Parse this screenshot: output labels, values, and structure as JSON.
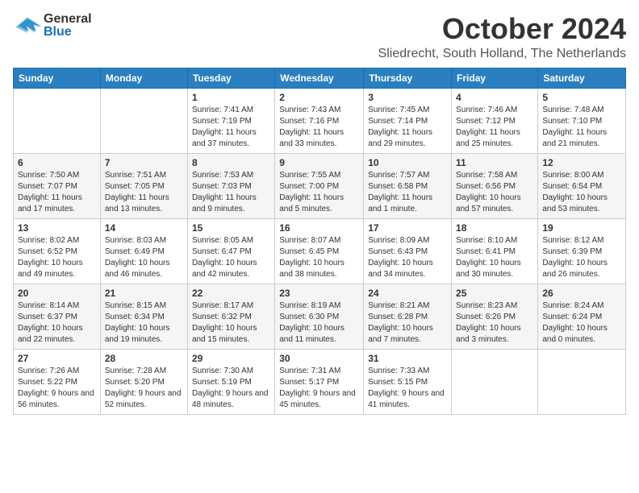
{
  "header": {
    "logo_general": "General",
    "logo_blue": "Blue",
    "month": "October 2024",
    "location": "Sliedrecht, South Holland, The Netherlands"
  },
  "days_of_week": [
    "Sunday",
    "Monday",
    "Tuesday",
    "Wednesday",
    "Thursday",
    "Friday",
    "Saturday"
  ],
  "weeks": [
    [
      {
        "day": "",
        "sunrise": "",
        "sunset": "",
        "daylight": ""
      },
      {
        "day": "",
        "sunrise": "",
        "sunset": "",
        "daylight": ""
      },
      {
        "day": "1",
        "sunrise": "Sunrise: 7:41 AM",
        "sunset": "Sunset: 7:19 PM",
        "daylight": "Daylight: 11 hours and 37 minutes."
      },
      {
        "day": "2",
        "sunrise": "Sunrise: 7:43 AM",
        "sunset": "Sunset: 7:16 PM",
        "daylight": "Daylight: 11 hours and 33 minutes."
      },
      {
        "day": "3",
        "sunrise": "Sunrise: 7:45 AM",
        "sunset": "Sunset: 7:14 PM",
        "daylight": "Daylight: 11 hours and 29 minutes."
      },
      {
        "day": "4",
        "sunrise": "Sunrise: 7:46 AM",
        "sunset": "Sunset: 7:12 PM",
        "daylight": "Daylight: 11 hours and 25 minutes."
      },
      {
        "day": "5",
        "sunrise": "Sunrise: 7:48 AM",
        "sunset": "Sunset: 7:10 PM",
        "daylight": "Daylight: 11 hours and 21 minutes."
      }
    ],
    [
      {
        "day": "6",
        "sunrise": "Sunrise: 7:50 AM",
        "sunset": "Sunset: 7:07 PM",
        "daylight": "Daylight: 11 hours and 17 minutes."
      },
      {
        "day": "7",
        "sunrise": "Sunrise: 7:51 AM",
        "sunset": "Sunset: 7:05 PM",
        "daylight": "Daylight: 11 hours and 13 minutes."
      },
      {
        "day": "8",
        "sunrise": "Sunrise: 7:53 AM",
        "sunset": "Sunset: 7:03 PM",
        "daylight": "Daylight: 11 hours and 9 minutes."
      },
      {
        "day": "9",
        "sunrise": "Sunrise: 7:55 AM",
        "sunset": "Sunset: 7:00 PM",
        "daylight": "Daylight: 11 hours and 5 minutes."
      },
      {
        "day": "10",
        "sunrise": "Sunrise: 7:57 AM",
        "sunset": "Sunset: 6:58 PM",
        "daylight": "Daylight: 11 hours and 1 minute."
      },
      {
        "day": "11",
        "sunrise": "Sunrise: 7:58 AM",
        "sunset": "Sunset: 6:56 PM",
        "daylight": "Daylight: 10 hours and 57 minutes."
      },
      {
        "day": "12",
        "sunrise": "Sunrise: 8:00 AM",
        "sunset": "Sunset: 6:54 PM",
        "daylight": "Daylight: 10 hours and 53 minutes."
      }
    ],
    [
      {
        "day": "13",
        "sunrise": "Sunrise: 8:02 AM",
        "sunset": "Sunset: 6:52 PM",
        "daylight": "Daylight: 10 hours and 49 minutes."
      },
      {
        "day": "14",
        "sunrise": "Sunrise: 8:03 AM",
        "sunset": "Sunset: 6:49 PM",
        "daylight": "Daylight: 10 hours and 46 minutes."
      },
      {
        "day": "15",
        "sunrise": "Sunrise: 8:05 AM",
        "sunset": "Sunset: 6:47 PM",
        "daylight": "Daylight: 10 hours and 42 minutes."
      },
      {
        "day": "16",
        "sunrise": "Sunrise: 8:07 AM",
        "sunset": "Sunset: 6:45 PM",
        "daylight": "Daylight: 10 hours and 38 minutes."
      },
      {
        "day": "17",
        "sunrise": "Sunrise: 8:09 AM",
        "sunset": "Sunset: 6:43 PM",
        "daylight": "Daylight: 10 hours and 34 minutes."
      },
      {
        "day": "18",
        "sunrise": "Sunrise: 8:10 AM",
        "sunset": "Sunset: 6:41 PM",
        "daylight": "Daylight: 10 hours and 30 minutes."
      },
      {
        "day": "19",
        "sunrise": "Sunrise: 8:12 AM",
        "sunset": "Sunset: 6:39 PM",
        "daylight": "Daylight: 10 hours and 26 minutes."
      }
    ],
    [
      {
        "day": "20",
        "sunrise": "Sunrise: 8:14 AM",
        "sunset": "Sunset: 6:37 PM",
        "daylight": "Daylight: 10 hours and 22 minutes."
      },
      {
        "day": "21",
        "sunrise": "Sunrise: 8:15 AM",
        "sunset": "Sunset: 6:34 PM",
        "daylight": "Daylight: 10 hours and 19 minutes."
      },
      {
        "day": "22",
        "sunrise": "Sunrise: 8:17 AM",
        "sunset": "Sunset: 6:32 PM",
        "daylight": "Daylight: 10 hours and 15 minutes."
      },
      {
        "day": "23",
        "sunrise": "Sunrise: 8:19 AM",
        "sunset": "Sunset: 6:30 PM",
        "daylight": "Daylight: 10 hours and 11 minutes."
      },
      {
        "day": "24",
        "sunrise": "Sunrise: 8:21 AM",
        "sunset": "Sunset: 6:28 PM",
        "daylight": "Daylight: 10 hours and 7 minutes."
      },
      {
        "day": "25",
        "sunrise": "Sunrise: 8:23 AM",
        "sunset": "Sunset: 6:26 PM",
        "daylight": "Daylight: 10 hours and 3 minutes."
      },
      {
        "day": "26",
        "sunrise": "Sunrise: 8:24 AM",
        "sunset": "Sunset: 6:24 PM",
        "daylight": "Daylight: 10 hours and 0 minutes."
      }
    ],
    [
      {
        "day": "27",
        "sunrise": "Sunrise: 7:26 AM",
        "sunset": "Sunset: 5:22 PM",
        "daylight": "Daylight: 9 hours and 56 minutes."
      },
      {
        "day": "28",
        "sunrise": "Sunrise: 7:28 AM",
        "sunset": "Sunset: 5:20 PM",
        "daylight": "Daylight: 9 hours and 52 minutes."
      },
      {
        "day": "29",
        "sunrise": "Sunrise: 7:30 AM",
        "sunset": "Sunset: 5:19 PM",
        "daylight": "Daylight: 9 hours and 48 minutes."
      },
      {
        "day": "30",
        "sunrise": "Sunrise: 7:31 AM",
        "sunset": "Sunset: 5:17 PM",
        "daylight": "Daylight: 9 hours and 45 minutes."
      },
      {
        "day": "31",
        "sunrise": "Sunrise: 7:33 AM",
        "sunset": "Sunset: 5:15 PM",
        "daylight": "Daylight: 9 hours and 41 minutes."
      },
      {
        "day": "",
        "sunrise": "",
        "sunset": "",
        "daylight": ""
      },
      {
        "day": "",
        "sunrise": "",
        "sunset": "",
        "daylight": ""
      }
    ]
  ]
}
